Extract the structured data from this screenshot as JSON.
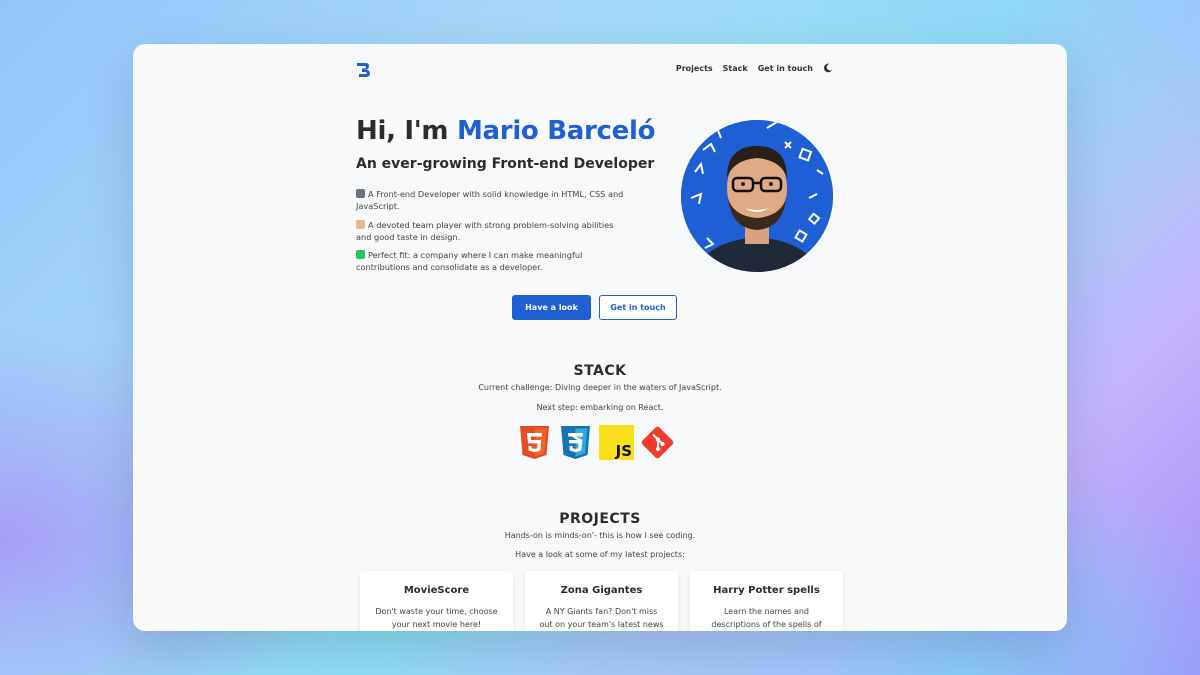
{
  "nav": {
    "links": [
      "Projects",
      "Stack",
      "Get in touch"
    ],
    "theme_icon": "moon-icon"
  },
  "hero": {
    "greeting": "Hi, I'm ",
    "name": "Mario Barceló",
    "subtitle": "An ever-growing Front-end Developer",
    "bullets": [
      "A Front-end Developer with solid knowledge in HTML, CSS and JavaScript.",
      "A devoted team player with strong problem-solving abilities and good taste in design.",
      "Perfect fit: a company where I can make meaningful contributions and consolidate as a developer."
    ],
    "primary_button": "Have a look",
    "secondary_button": "Get in touch"
  },
  "stack": {
    "title": "STACK",
    "line1": "Current challenge: Diving deeper in the waters of JavaScript.",
    "line2": "Next step: embarking on React.",
    "icons": [
      "html5-icon",
      "css3-icon",
      "javascript-icon",
      "git-icon"
    ],
    "js_label": "JS"
  },
  "projects": {
    "title": "PROJECTS",
    "line1": "Hands-on is minds-on'- this is how I see coding.",
    "line2": "Have a look at some of my latest projects:",
    "cards": [
      {
        "title": "MovieScore",
        "desc": "Don't waste your time, choose your next movie here!"
      },
      {
        "title": "Zona Gigantes",
        "desc": "A NY Giants fan? Don't miss out on your team's latest news in"
      },
      {
        "title": "Harry Potter spells",
        "desc": "Learn the names and descriptions of the spells of the"
      }
    ]
  },
  "colors": {
    "accent": "#1f5fd1",
    "text": "#2c2c2c",
    "page_bg": "#f8f9fa"
  }
}
